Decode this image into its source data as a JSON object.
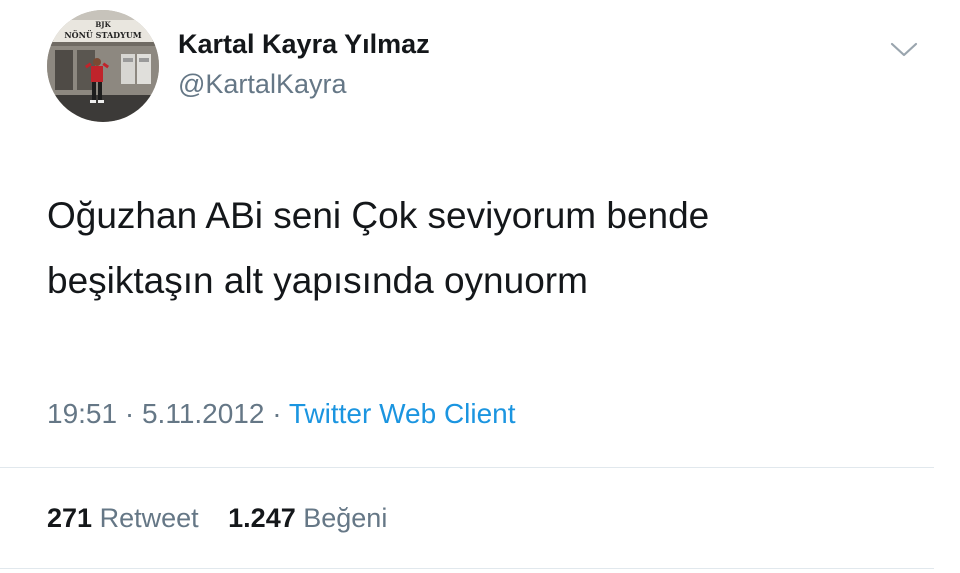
{
  "author": {
    "display_name": "Kartal Kayra Yılmaz",
    "handle": "@KartalKayra",
    "avatar_sign_top": "BJK",
    "avatar_sign_main": "NÖNÜ STADYUM"
  },
  "tweet": {
    "line1": "Oğuzhan ABi seni Çok seviyorum bende",
    "line2": "beşiktaşın alt yapısında oynuorm"
  },
  "meta": {
    "time": "19:51",
    "separator": "·",
    "date": "5.11.2012",
    "source": "Twitter Web Client"
  },
  "stats": {
    "retweets": "271",
    "retweets_label": "Retweet",
    "likes": "1.247",
    "likes_label": "Beğeni"
  },
  "colors": {
    "text": "#14171a",
    "secondary": "#657786",
    "link": "#1b95e0",
    "divider": "#e1e8ed"
  },
  "icons": {
    "menu": "chevron-down-icon"
  }
}
